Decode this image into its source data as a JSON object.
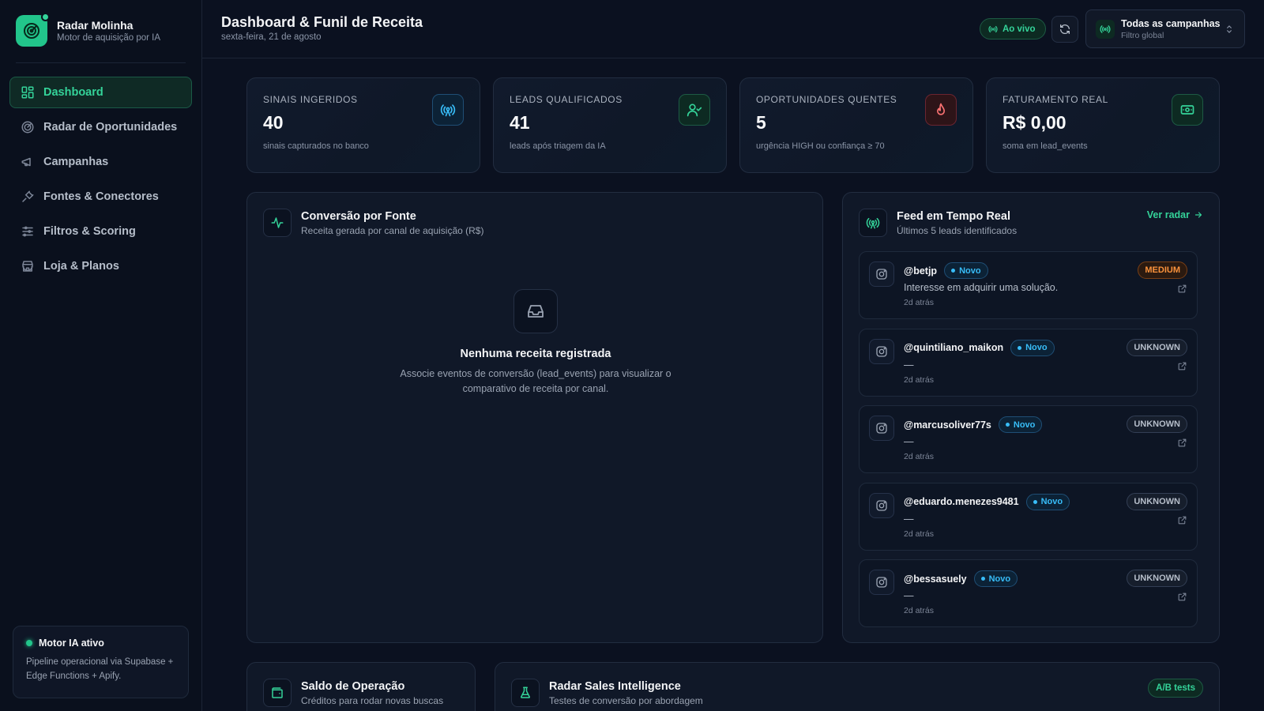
{
  "brand": {
    "name": "Radar Molinha",
    "tagline": "Motor de aquisição por IA"
  },
  "nav": [
    {
      "label": "Dashboard",
      "icon": "dashboard-icon",
      "active": true
    },
    {
      "label": "Radar de Oportunidades",
      "icon": "radar-icon"
    },
    {
      "label": "Campanhas",
      "icon": "megaphone-icon"
    },
    {
      "label": "Fontes & Conectores",
      "icon": "plug-icon"
    },
    {
      "label": "Filtros & Scoring",
      "icon": "sliders-icon"
    },
    {
      "label": "Loja & Planos",
      "icon": "store-icon"
    }
  ],
  "ai_status": {
    "title": "Motor IA ativo",
    "description": "Pipeline operacional via Supabase + Edge Functions + Apify."
  },
  "header": {
    "title": "Dashboard & Funil de Receita",
    "date": "sexta-feira, 21 de agosto",
    "live_label": "Ao vivo",
    "campaign_title": "Todas as campanhas",
    "campaign_sub": "Filtro global"
  },
  "kpis": [
    {
      "label": "Sinais ingeridos",
      "value": "40",
      "desc": "sinais capturados no banco",
      "icon": "antenna-icon",
      "color": "#38bdf8"
    },
    {
      "label": "Leads qualificados",
      "value": "41",
      "desc": "leads após triagem da IA",
      "icon": "user-check-icon",
      "color": "#34d399"
    },
    {
      "label": "Oportunidades quentes",
      "value": "5",
      "desc": "urgência HIGH ou confiança ≥ 70",
      "icon": "flame-icon",
      "color": "#f87171"
    },
    {
      "label": "Faturamento real",
      "value": "R$ 0,00",
      "desc": "soma em lead_events",
      "icon": "banknote-icon",
      "color": "#34d399"
    }
  ],
  "conversion": {
    "title": "Conversão por Fonte",
    "subtitle": "Receita gerada por canal de aquisição (R$)",
    "empty_title": "Nenhuma receita registrada",
    "empty_desc": "Associe eventos de conversão (lead_events) para visualizar o comparativo de receita por canal."
  },
  "feed": {
    "title": "Feed em Tempo Real",
    "subtitle": "Últimos 5 leads identificados",
    "link": "Ver radar",
    "items": [
      {
        "handle": "@betjp",
        "status": "Novo",
        "message": "Interesse em adquirir uma solução.",
        "time": "2d atrás",
        "badge": "MEDIUM",
        "badge_type": "medium"
      },
      {
        "handle": "@quintiliano_maikon",
        "status": "Novo",
        "message": "—",
        "time": "2d atrás",
        "badge": "UNKNOWN",
        "badge_type": "unknown"
      },
      {
        "handle": "@marcusoliver77s",
        "status": "Novo",
        "message": "—",
        "time": "2d atrás",
        "badge": "UNKNOWN",
        "badge_type": "unknown"
      },
      {
        "handle": "@eduardo.menezes9481",
        "status": "Novo",
        "message": "—",
        "time": "2d atrás",
        "badge": "UNKNOWN",
        "badge_type": "unknown"
      },
      {
        "handle": "@bessasuely",
        "status": "Novo",
        "message": "—",
        "time": "2d atrás",
        "badge": "UNKNOWN",
        "badge_type": "unknown"
      }
    ]
  },
  "balance": {
    "title": "Saldo de Operação",
    "subtitle": "Créditos para rodar novas buscas"
  },
  "intel": {
    "title": "Radar Sales Intelligence",
    "subtitle": "Testes de conversão por abordagem",
    "badge": "A/B tests"
  }
}
